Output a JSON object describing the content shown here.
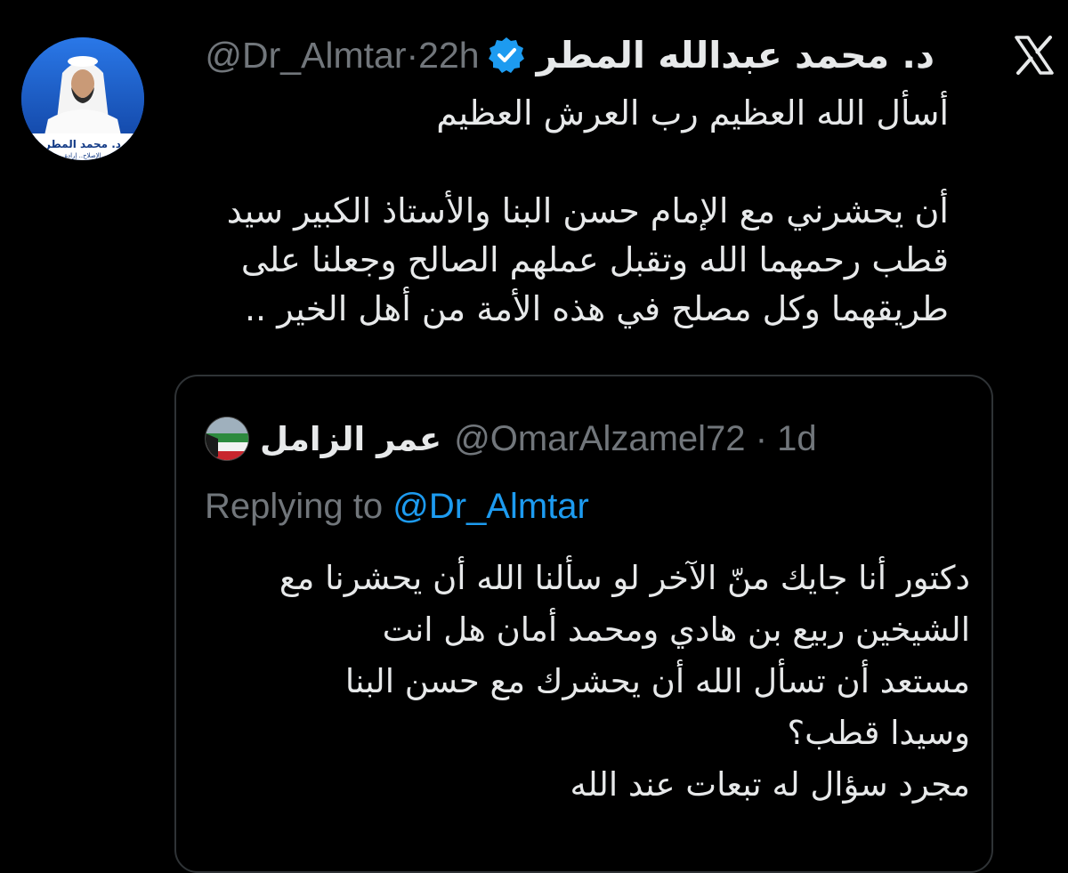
{
  "tweet": {
    "author_name": "د. محمد عبدالله المطر",
    "handle": "@Dr_Almtar",
    "separator": "·",
    "time": "22h",
    "avatar_text": {
      "line1": "د. محمد المطر",
      "line2": "الإصلاح.. إرادة"
    },
    "text_lines": [
      "أسأل الله العظيم رب العرش العظيم",
      "",
      "أن يحشرني مع الإمام حسن البنا والأستاذ الكبير سيد",
      "قطب رحمهما الله وتقبل عملهم الصالح وجعلنا على",
      "طريقهما وكل مصلح في هذه الأمة من أهل الخير .."
    ]
  },
  "quoted_tweet": {
    "author_name": "عمر الزامل",
    "handle": "@OmarAlzamel72",
    "separator": "·",
    "time": "1d",
    "replying_prefix": "Replying to",
    "replying_to": "@Dr_Almtar",
    "text_lines": [
      "دكتور أنا جايك منّ الآخر لو سألنا الله أن يحشرنا مع",
      "الشيخين ربيع بن هادي ومحمد أمان هل انت",
      "مستعد أن تسأل الله أن يحشرك مع حسن البنا",
      "وسيدا قطب؟",
      "مجرد سؤال له تبعات عند الله"
    ]
  },
  "icons": {
    "logo": "x-logo-icon",
    "verified": "verified-badge-icon"
  },
  "colors": {
    "background": "#000000",
    "text": "#e7e9ea",
    "muted": "#71767b",
    "accent": "#1d9bf0",
    "border": "#2f3336"
  }
}
